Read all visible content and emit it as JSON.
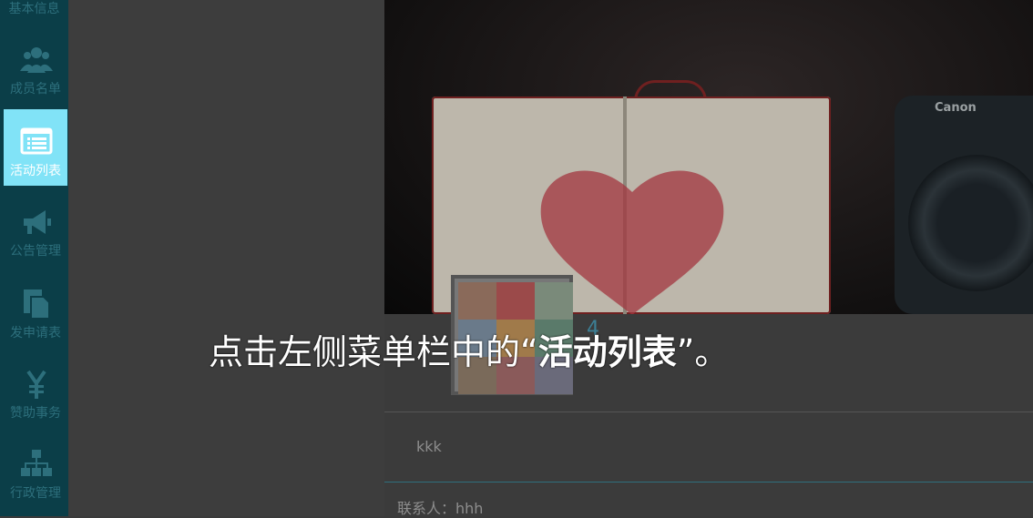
{
  "sidebar": {
    "top_label": "基本信息",
    "items": [
      {
        "label": "成员名单",
        "icon": "users-icon"
      },
      {
        "label": "活动列表",
        "icon": "list-icon"
      },
      {
        "label": "公告管理",
        "icon": "megaphone-icon"
      },
      {
        "label": "发申请表",
        "icon": "document-icon"
      },
      {
        "label": "赞助事务",
        "icon": "yen-icon"
      },
      {
        "label": "行政管理",
        "icon": "org-chart-icon"
      }
    ],
    "active_index": 1
  },
  "hero": {
    "camera_brand": "Canon"
  },
  "content": {
    "name_partial": "4",
    "description": "kkk",
    "contact_label": "联系人：",
    "contact_value": "hhh"
  },
  "overlay": {
    "prefix": "点击左侧菜单栏中的“",
    "highlight": "活动列表",
    "suffix": "”。"
  },
  "colors": {
    "sidebar_bg": "#0b3e48",
    "active_bg": "#81e3f7",
    "muted_teal": "#2d6f7c"
  }
}
